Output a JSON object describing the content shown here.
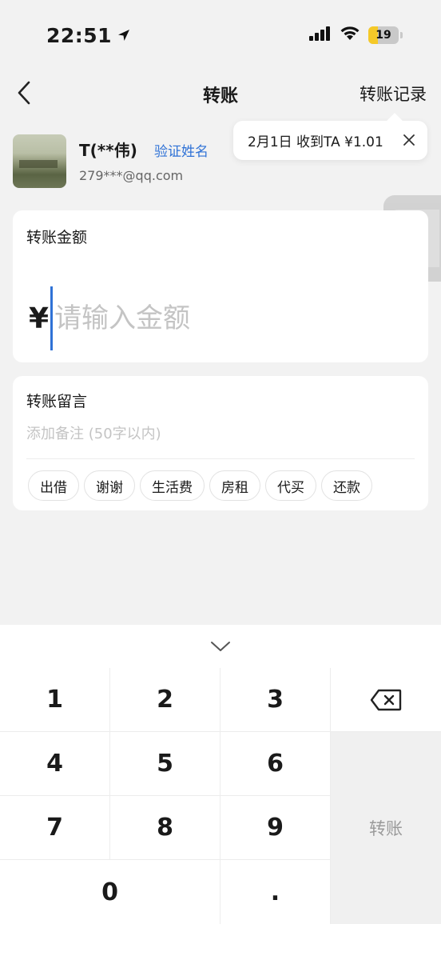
{
  "status_bar": {
    "time": "22:51",
    "battery_level": "19",
    "icons": [
      "location-arrow-icon",
      "signal-icon",
      "wifi-icon",
      "battery-icon"
    ]
  },
  "nav": {
    "title": "转账",
    "record_link": "转账记录"
  },
  "payee": {
    "name": "T(**伟)",
    "verify_link": "验证姓名",
    "account": "279***@qq.com"
  },
  "tooltip": {
    "text": "2月1日  收到TA  ¥1.01"
  },
  "amount": {
    "label": "转账金额",
    "currency_symbol": "¥",
    "placeholder": "请输入金额"
  },
  "message": {
    "label": "转账留言",
    "placeholder": "添加备注 (50字以内)",
    "chips": [
      "出借",
      "谢谢",
      "生活费",
      "房租",
      "代买",
      "还款"
    ]
  },
  "keyboard": {
    "keys": {
      "k1": "1",
      "k2": "2",
      "k3": "3",
      "k4": "4",
      "k5": "5",
      "k6": "6",
      "k7": "7",
      "k8": "8",
      "k9": "9",
      "k0": "0",
      "dot": "."
    },
    "confirm_label": "转账"
  }
}
